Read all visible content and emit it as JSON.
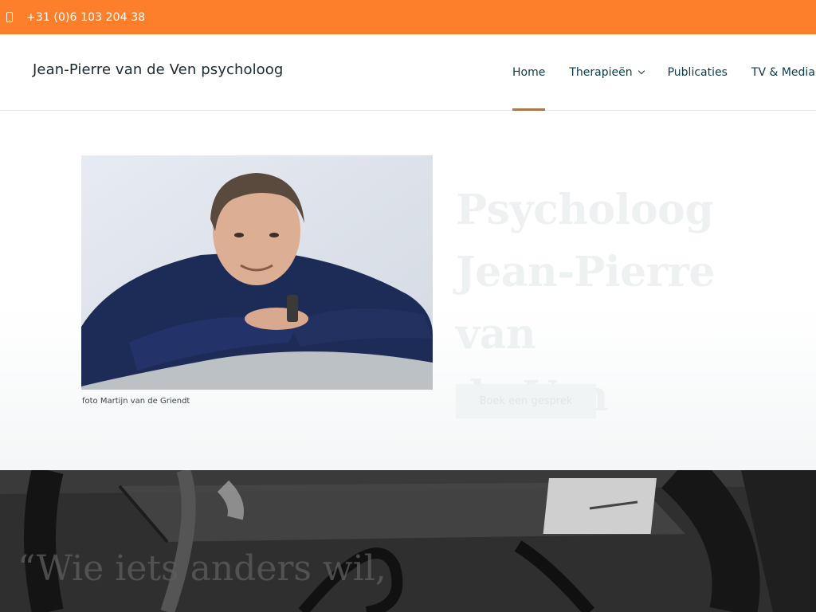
{
  "topbar": {
    "phone_icon": "mobile-phone-icon",
    "phone": "+31 (0)6 103 204 38",
    "color": "#fd7e2b"
  },
  "header": {
    "site_title": "Jean-Pierre van de Ven psycholoog",
    "nav": [
      {
        "label": "Home",
        "active": true,
        "dropdown": false
      },
      {
        "label": "Therapieën",
        "active": false,
        "dropdown": true
      },
      {
        "label": "Publicaties",
        "active": false,
        "dropdown": false
      },
      {
        "label": "TV & Media",
        "active": false,
        "dropdown": true
      }
    ],
    "active_underline_color": "#a9784a"
  },
  "hero": {
    "photo_caption": "foto Martijn van de Griendt",
    "title_lines": [
      "Psycholoog",
      "Jean-Pierre van",
      "de Ven"
    ],
    "cta_label": "Boek een gesprek"
  },
  "band": {
    "quote": "“Wie iets anders wil,"
  }
}
